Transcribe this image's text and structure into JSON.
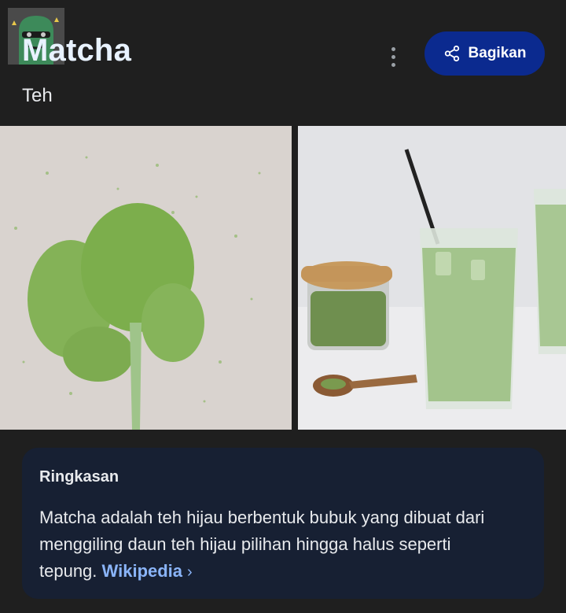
{
  "header": {
    "title": "Matcha",
    "subtitle": "Teh",
    "share_label": "Bagikan"
  },
  "summary": {
    "heading": "Ringkasan",
    "text": "Matcha adalah teh hijau berbentuk bubuk yang dibuat dari menggiling daun teh hijau pilihan hingga halus seperti tepung.",
    "source_label": "Wikipedia",
    "source_chevron": "›"
  },
  "colors": {
    "background": "#1f1f1f",
    "share_button": "#0b2a8f",
    "card_background": "#172033",
    "link": "#8ab4f8",
    "matcha_green": "#7fb04f"
  },
  "icons": {
    "more": "more-vert-icon",
    "share": "share-icon",
    "chevron": "chevron-right-icon"
  }
}
